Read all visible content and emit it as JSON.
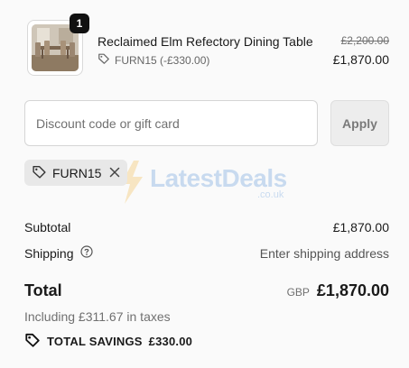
{
  "product": {
    "quantity": "1",
    "title": "Reclaimed Elm Refectory Dining Table",
    "discount_code": "FURN15 (-£330.00)",
    "compare_price": "£2,200.00",
    "final_price": "£1,870.00",
    "thumbnail_icon": "dining-table-image"
  },
  "discount": {
    "placeholder": "Discount code or gift card",
    "value": "",
    "apply_label": "Apply"
  },
  "applied_code": {
    "code": "FURN15",
    "tag_icon": "tag-icon",
    "remove_icon": "close-icon"
  },
  "watermark": {
    "text": "LatestDeals",
    "sub": ".co.uk"
  },
  "summary": {
    "subtotal_label": "Subtotal",
    "subtotal_value": "£1,870.00",
    "shipping_label": "Shipping",
    "shipping_help_icon": "help-circle-icon",
    "shipping_value": "Enter shipping address",
    "total_label": "Total",
    "currency": "GBP",
    "total_value": "£1,870.00",
    "taxes": "Including £311.67 in taxes",
    "savings_label": "TOTAL SAVINGS",
    "savings_value": "£330.00"
  },
  "colors": {
    "background": "#fafafa",
    "text": "#1a1a1a",
    "muted": "#707070",
    "chip": "#e8e8e8",
    "button_disabled": "#ededed"
  }
}
